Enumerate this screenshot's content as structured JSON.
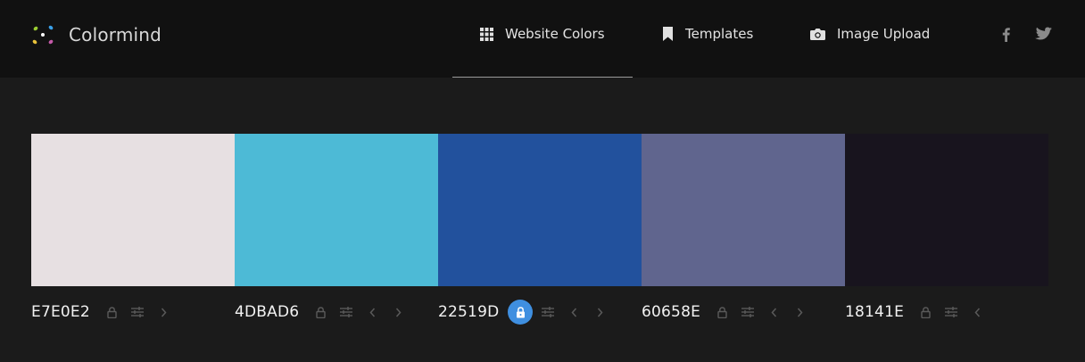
{
  "brand": {
    "name": "Colormind"
  },
  "nav": {
    "website_colors": "Website Colors",
    "templates": "Templates",
    "image_upload": "Image Upload"
  },
  "palette": [
    {
      "hex": "E7E0E2",
      "color": "#E7E0E2",
      "locked": false,
      "arrows": [
        "right"
      ]
    },
    {
      "hex": "4DBAD6",
      "color": "#4DBAD6",
      "locked": false,
      "arrows": [
        "left",
        "right"
      ]
    },
    {
      "hex": "22519D",
      "color": "#22519D",
      "locked": true,
      "arrows": [
        "left",
        "right"
      ]
    },
    {
      "hex": "60658E",
      "color": "#60658E",
      "locked": false,
      "arrows": [
        "left",
        "right"
      ]
    },
    {
      "hex": "18141E",
      "color": "#18141E",
      "locked": false,
      "arrows": [
        "left"
      ]
    }
  ],
  "colors": {
    "page_bg": "#1b1b1b",
    "header_bg": "#111111",
    "lock_active_bg": "#3f8fe0",
    "muted_icon": "#5a5a5a",
    "nav_icon": "#e0e0e0",
    "social_icon": "#8a8a8a"
  },
  "icons": {
    "website_colors": "grid-icon",
    "templates": "bookmark-icon",
    "image_upload": "camera-icon",
    "facebook": "facebook-icon",
    "twitter": "twitter-icon",
    "lock": "lock-icon",
    "adjust": "sliders-icon",
    "shift_left": "chevron-left-icon",
    "shift_right": "chevron-right-icon"
  }
}
